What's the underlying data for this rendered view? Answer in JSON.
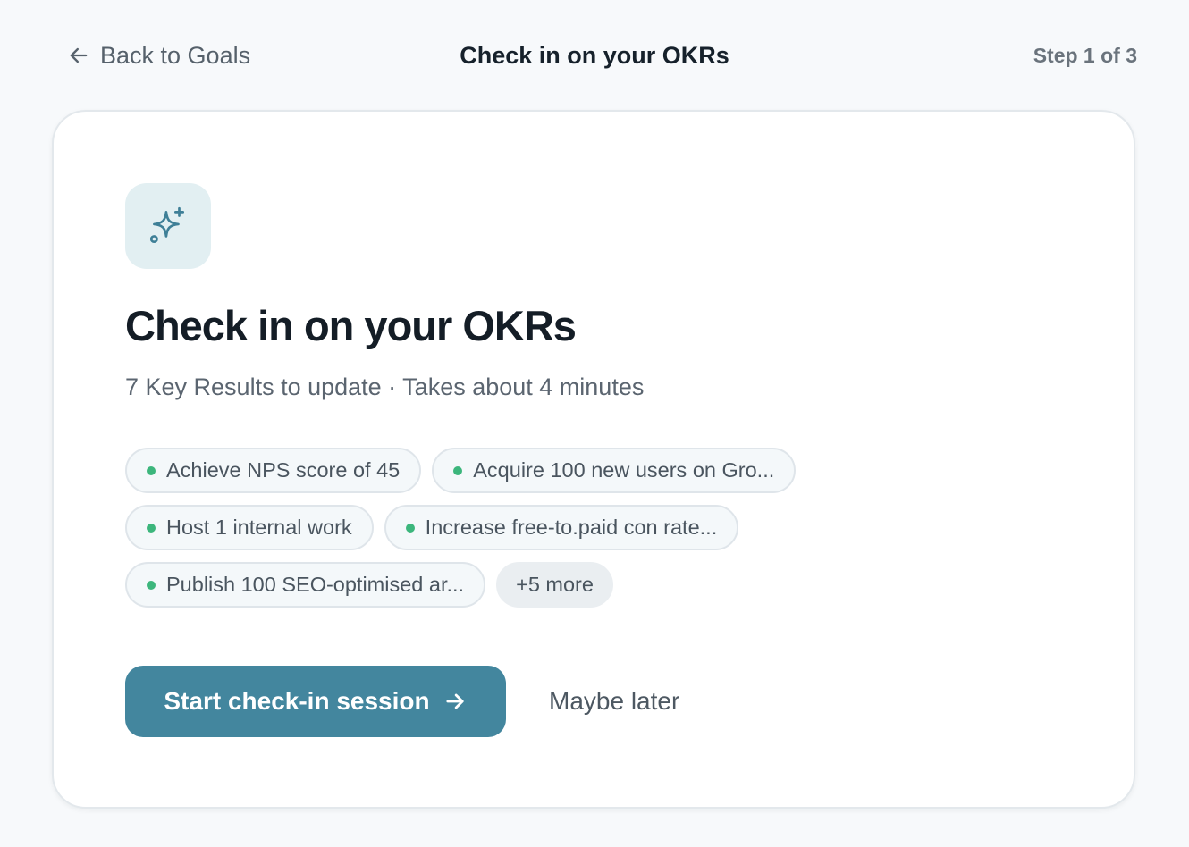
{
  "header": {
    "back_label": "Back to Goals",
    "title": "Check in on your OKRs",
    "step": "Step 1 of 3"
  },
  "card": {
    "icon": "sparkles-icon",
    "title": "Check in on your OKRs",
    "subtitle": "7 Key Results to update · Takes about 4 minutes",
    "chips": [
      "Achieve NPS score of 45",
      "Acquire 100 new users on Gro...",
      "Host 1 internal work",
      "Increase free-to.paid con rate...",
      "Publish 100 SEO-optimised ar..."
    ],
    "more_label": "+5 more",
    "primary_label": "Start check-in session",
    "secondary_label": "Maybe later"
  },
  "colors": {
    "accent": "#43869e",
    "status_dot": "#3cb67c",
    "icon_tile": "#e2eff2"
  }
}
